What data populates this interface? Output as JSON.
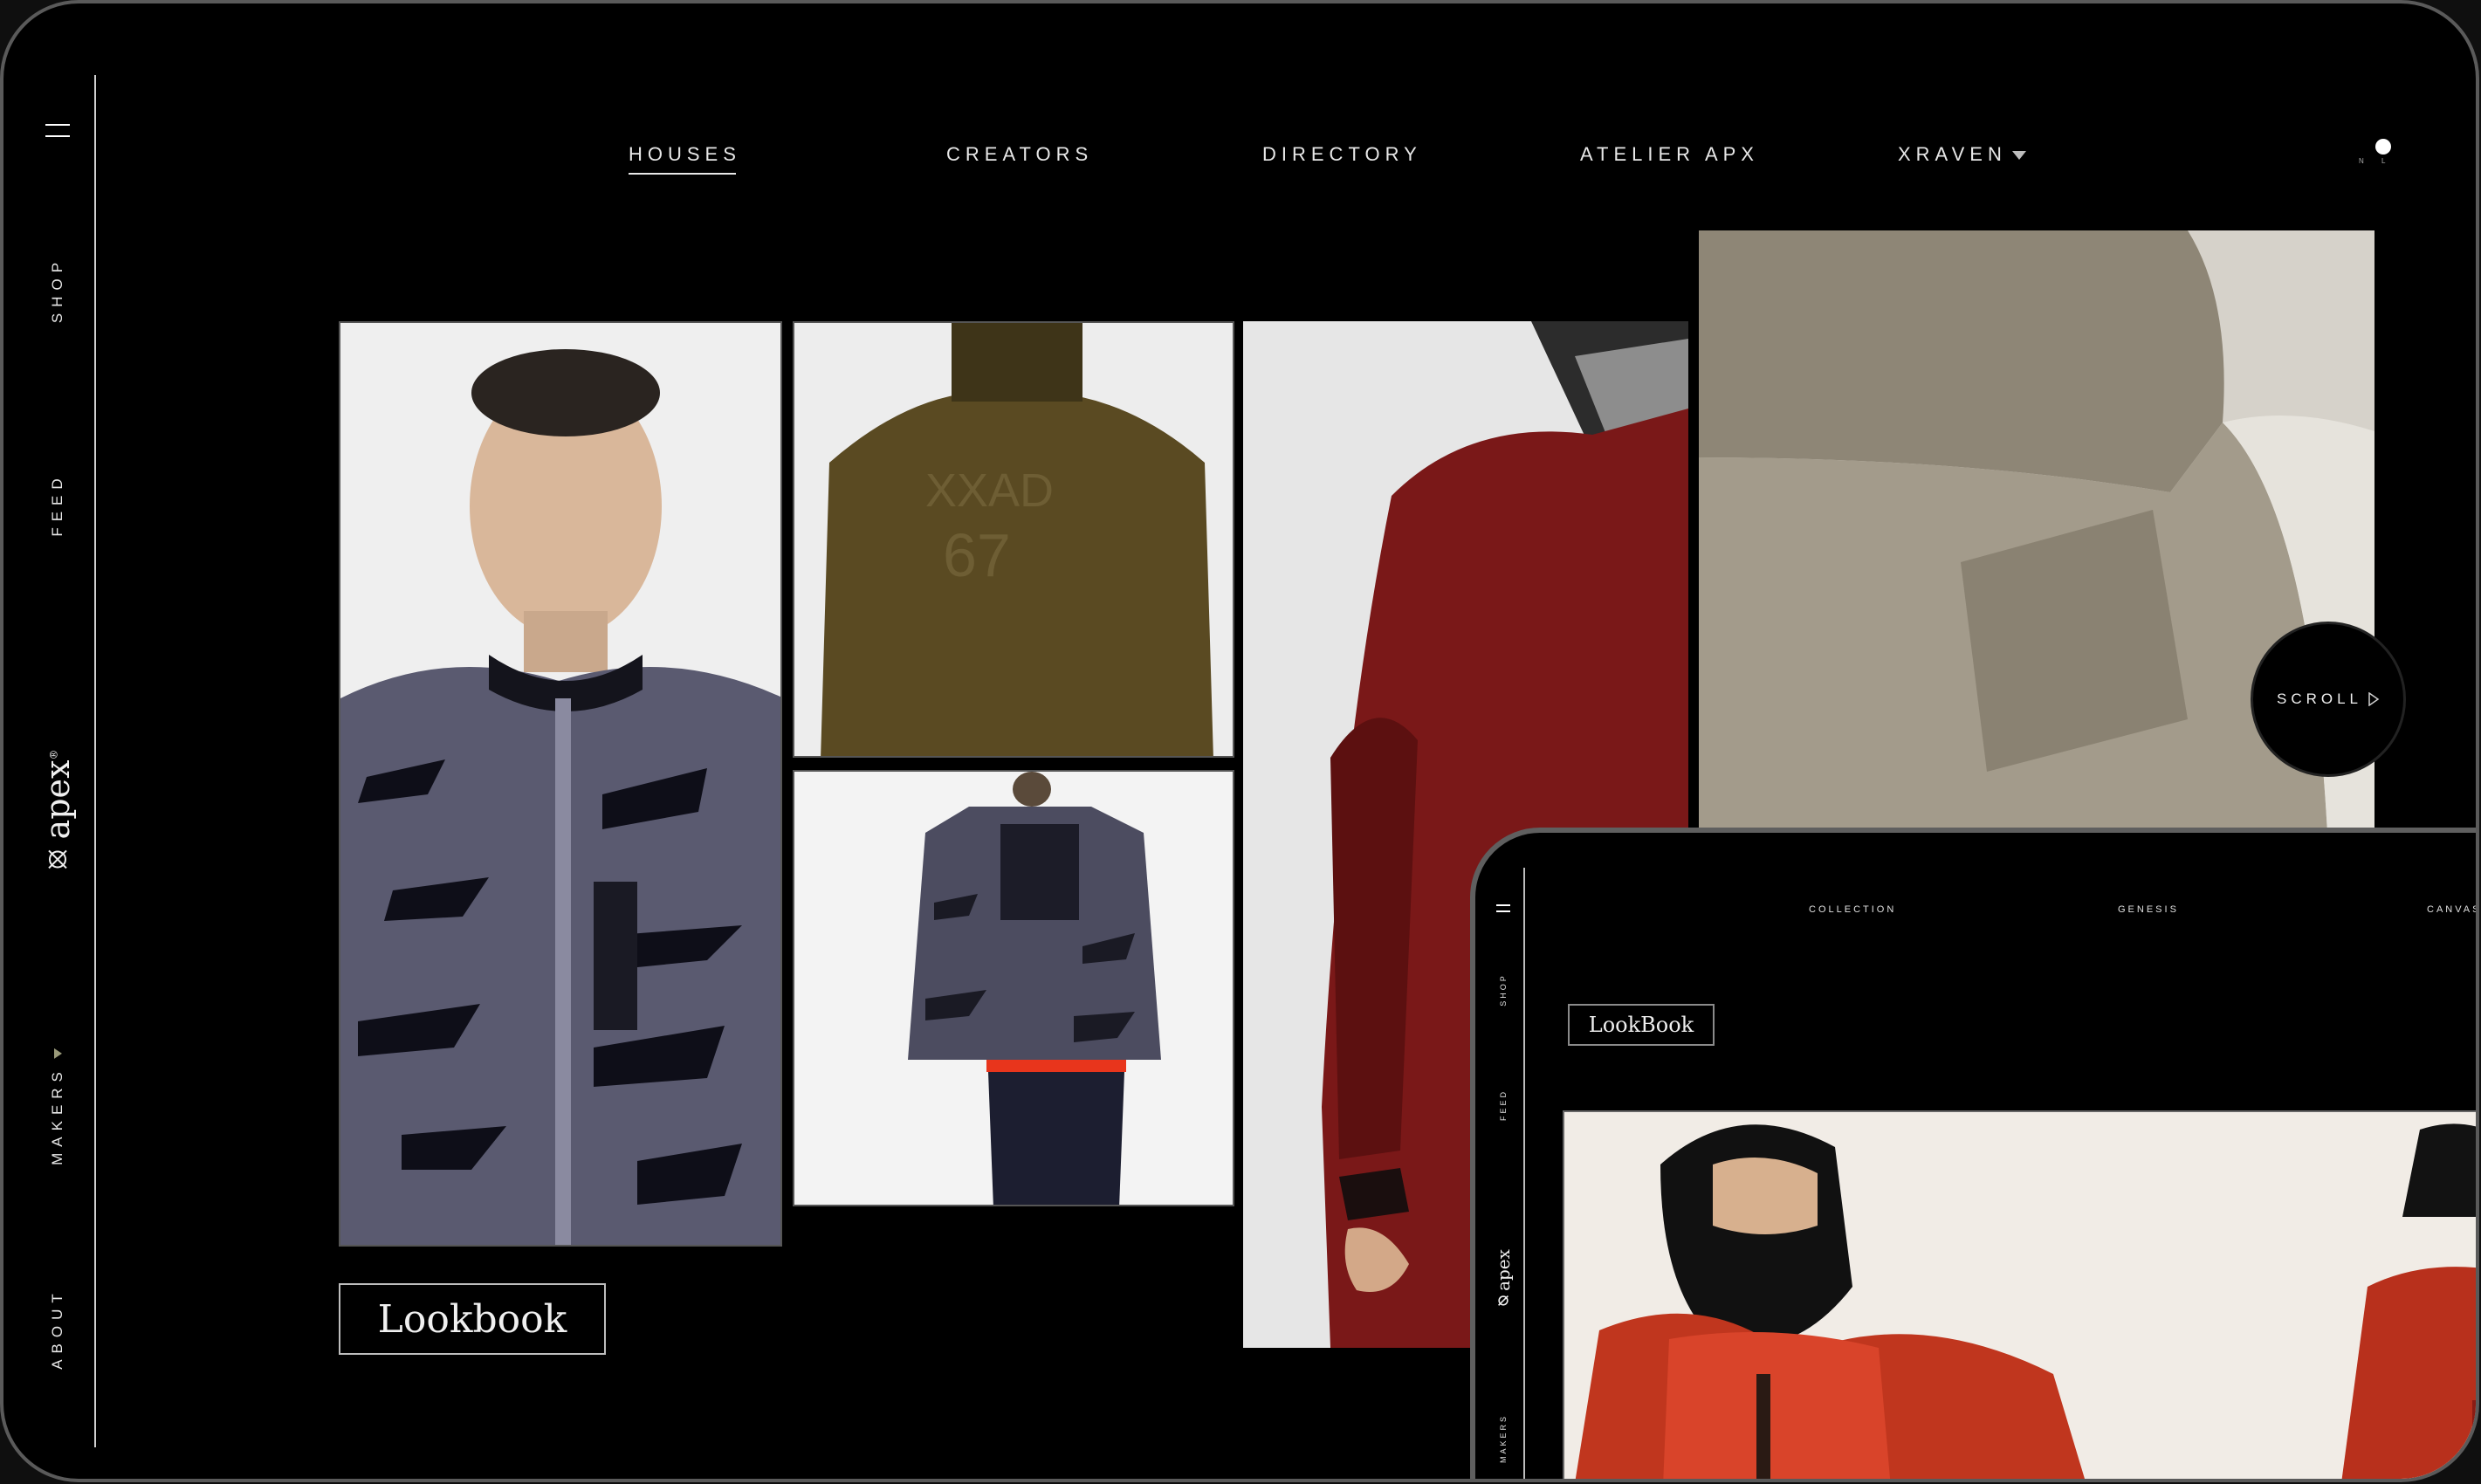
{
  "sidebar": {
    "items": [
      {
        "label": "SHOP"
      },
      {
        "label": "FEED"
      },
      {
        "label": "MAKERS"
      },
      {
        "label": "ABOUT"
      }
    ],
    "logo_text": "apex",
    "logo_mark": "®"
  },
  "nav": {
    "items": [
      {
        "label": "HOUSES",
        "active": true
      },
      {
        "label": "CREATORS"
      },
      {
        "label": "DIRECTORY"
      },
      {
        "label": "ATELIER APX"
      },
      {
        "label": "XRAVEN",
        "dropdown": true
      }
    ]
  },
  "theme_toggle": {
    "left_label": "N",
    "right_label": "L"
  },
  "gallery": {
    "caption": "Lookbook",
    "images": [
      "model-velvet-bomber-front",
      "olive-hooded-jacket-back",
      "velvet-bomber-back-full",
      "red-bomber-side",
      "taupe-jacket-sleeve-detail"
    ]
  },
  "scroll_button": {
    "label": "SCROLL"
  },
  "tablet": {
    "sidebar": [
      {
        "label": "SHOP"
      },
      {
        "label": "FEED"
      },
      {
        "label": "MAKERS"
      }
    ],
    "logo_text": "apex",
    "nav": [
      {
        "label": "COLLECTION"
      },
      {
        "label": "GENESIS"
      },
      {
        "label": "CANVAS"
      }
    ],
    "caption": "LookBook"
  },
  "colors": {
    "background": "#000000",
    "frame": "#5a5a5a",
    "text": "#e8e8e8",
    "accent_caret": "#9a9a7a"
  }
}
